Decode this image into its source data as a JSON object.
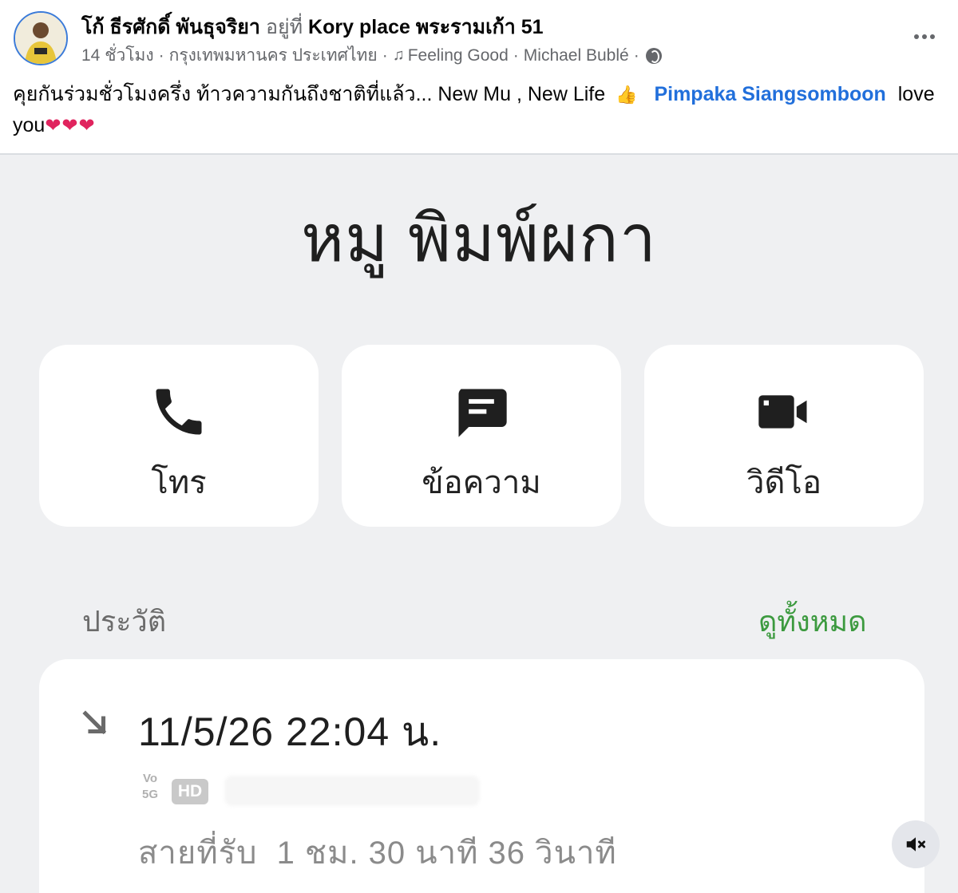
{
  "post": {
    "author_name": "โก้ ธีรศักดิ์ พันธุจริยา",
    "at_word": "อยู่ที่",
    "place": "Kory place พระรามเก้า 51",
    "time_ago": "14 ชั่วโมง",
    "location": "กรุงเทพมหานคร ประเทศไทย",
    "song": "Feeling Good",
    "artist": "Michael Bublé",
    "separator": "·",
    "caption_text": "คุยกันร่วมชั่วโมงครึ่ง ท้าวความกันถึงชาติที่แล้ว... New Mu , New Life",
    "mention": "Pimpaka Siangsomboon",
    "caption_end": "love you",
    "hearts": "❤❤❤",
    "icons": {
      "more": "more-horizontal-icon",
      "music": "music-note-icon",
      "privacy": "globe-icon",
      "hand": "thumbs-up-hand-emoji"
    }
  },
  "screenshot": {
    "contact_name": "หมู พิมพ์ผกา",
    "actions": [
      {
        "label": "โทร",
        "icon": "phone-icon"
      },
      {
        "label": "ข้อความ",
        "icon": "message-icon"
      },
      {
        "label": "วิดีโอ",
        "icon": "video-camera-icon"
      }
    ],
    "history_title": "ประวัติ",
    "see_all": "ดูทั้งหมด",
    "call": {
      "direction_icon": "incoming-call-arrow-icon",
      "time": "11/5/26 22:04 น.",
      "volte_badge_top": "Vo",
      "volte_badge_bottom": "5G",
      "hd_badge": "HD",
      "duration_label": "สายที่รับ",
      "duration_value": "1 ชม. 30 นาที 36 วินาที"
    },
    "mute_icon": "muted-speaker-icon"
  },
  "colors": {
    "link_blue": "#216fdb",
    "see_all_green": "#3c9a3f",
    "screenshot_bg": "#eff0f2",
    "card_bg": "#ffffff",
    "heart_red": "#e0245e"
  }
}
